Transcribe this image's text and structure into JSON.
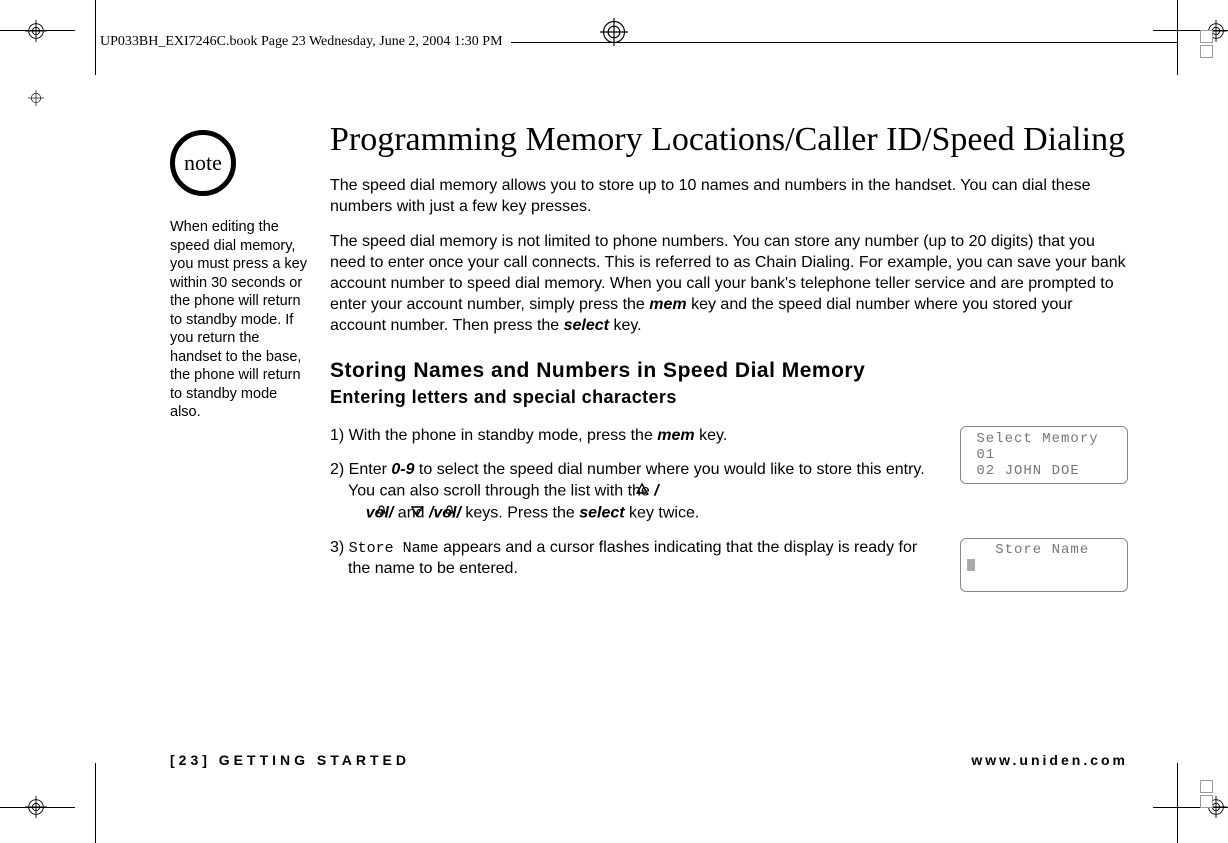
{
  "header": "UP033BH_EXI7246C.book  Page 23  Wednesday, June 2, 2004  1:30 PM",
  "note": {
    "badge": "note",
    "text": "When editing the speed dial memory, you must press a key within 30 seconds or the phone will return to standby mode. If you return the handset to the base, the phone will return to standby mode also."
  },
  "title": "Programming Memory Locations/Caller ID/Speed Dialing",
  "intro1": "The speed dial memory allows you to store up to 10 names and numbers in the handset. You can dial these numbers with just a few key presses.",
  "intro2_a": "The speed dial memory is not limited to phone numbers. You can store any number (up to 20 digits) that you need to enter once your call connects. This is referred to as Chain Dialing. For example, you can save your bank account number to speed dial memory. When you call your bank's telephone teller service and are prompted to enter your account number, simply press the ",
  "intro2_mem": "mem",
  "intro2_b": " key and the speed dial number where you stored your account number. Then press the ",
  "intro2_select": "select",
  "intro2_c": " key.",
  "subheading": "Storing Names and Numbers in Speed Dial Memory",
  "subsub": "Entering letters and special characters",
  "step1_a": "1) With the phone in standby mode, press the ",
  "step1_mem": "mem",
  "step1_b": " key.",
  "step2_a": "2) Enter ",
  "step2_09": "0-9",
  "step2_b": " to select the speed dial number where you would like to store this entry. You can also scroll through the list with the ",
  "step2_vol1": "vol/",
  "step2_and": " and ",
  "step2_vol2": "/vol/",
  "step2_c": " keys. Press the ",
  "step2_select": "select",
  "step2_d": " key twice.",
  "step3_a": "3) ",
  "step3_storename": "Store Name",
  "step3_b": " appears and a cursor flashes indicating that the display is ready for the name to be entered.",
  "lcd1": " Select Memory\n 01\n 02 JOHN DOE",
  "lcd2_title": "   Store Name",
  "footer_left": "[23] GETTING STARTED",
  "footer_right": "www.uniden.com"
}
